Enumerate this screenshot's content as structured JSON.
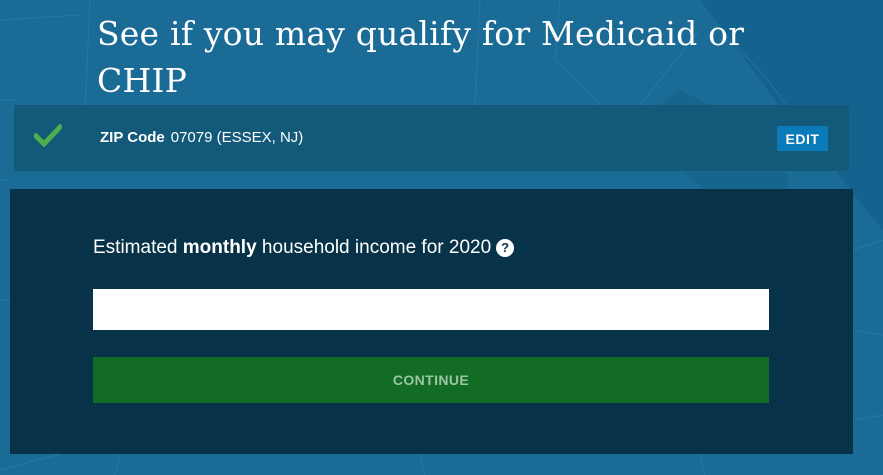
{
  "header": {
    "title": "See if you may qualify for Medicaid or CHIP"
  },
  "zip_bar": {
    "label": "ZIP Code",
    "value": "07079 (ESSEX, NJ)",
    "edit_label": "EDIT",
    "check_color": "#4cae4c"
  },
  "form": {
    "label_prefix": "Estimated ",
    "label_bold": "monthly",
    "label_suffix": " household income for 2020",
    "help_icon": "question-circle-icon",
    "help_glyph": "?",
    "income_value": "",
    "continue_label": "CONTINUE"
  },
  "colors": {
    "background": "#1a6c97",
    "zip_bar": "#135a7a",
    "panel": "#083248",
    "edit_button": "#0b7ab8",
    "continue_button": "#126c24"
  }
}
